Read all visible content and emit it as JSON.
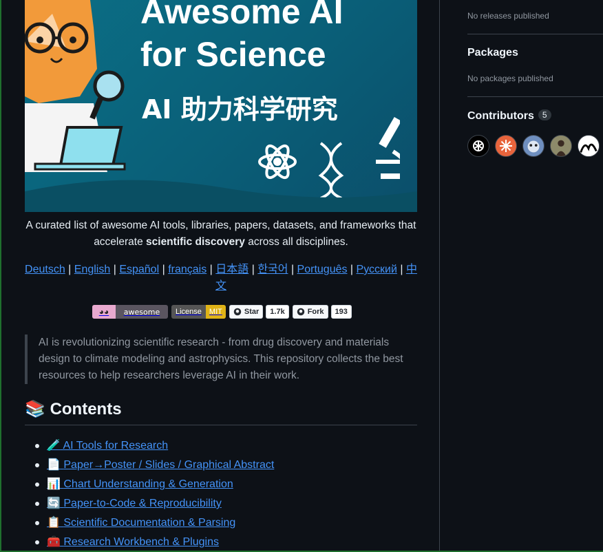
{
  "hero": {
    "title_line1": "Awesome AI",
    "title_line2": "for Science",
    "subtitle": "AI 助力科学研究"
  },
  "description": {
    "before": "A curated list of awesome AI tools, libraries, papers, datasets, and frameworks that accelerate ",
    "bold": "scientific discovery",
    "after": " across all disciplines."
  },
  "languages": [
    "Deutsch",
    "English",
    "Español",
    "français",
    "日本語",
    "한국어",
    "Português",
    "Русский",
    "中文"
  ],
  "badges": {
    "awesome": "awesome",
    "license_label": "License",
    "license_value": "MIT",
    "star_label": "Star",
    "star_count": "1.7k",
    "fork_label": "Fork",
    "fork_count": "193"
  },
  "quote": "AI is revolutionizing scientific research - from drug discovery and materials design to climate modeling and astrophysics. This repository collects the best resources to help researchers leverage AI in their work.",
  "contents": {
    "heading_emoji": "📚",
    "heading": "Contents",
    "items": [
      {
        "emoji": "🧪",
        "label": "AI Tools for Research"
      },
      {
        "emoji": "📄",
        "label": "Paper→Poster / Slides / Graphical Abstract"
      },
      {
        "emoji": "📊",
        "label": "Chart Understanding & Generation"
      },
      {
        "emoji": "🔄",
        "label": "Paper-to-Code & Reproducibility"
      },
      {
        "emoji": "📋",
        "label": "Scientific Documentation & Parsing"
      },
      {
        "emoji": "🧰",
        "label": "Research Workbench & Plugins"
      }
    ]
  },
  "sidebar": {
    "releases_empty": "No releases published",
    "packages_heading": "Packages",
    "packages_empty": "No packages published",
    "contributors_heading": "Contributors",
    "contributors_count": "5"
  },
  "colors": {
    "link": "#4493f8",
    "background": "#0d1117",
    "hero": "#0b6f86"
  }
}
